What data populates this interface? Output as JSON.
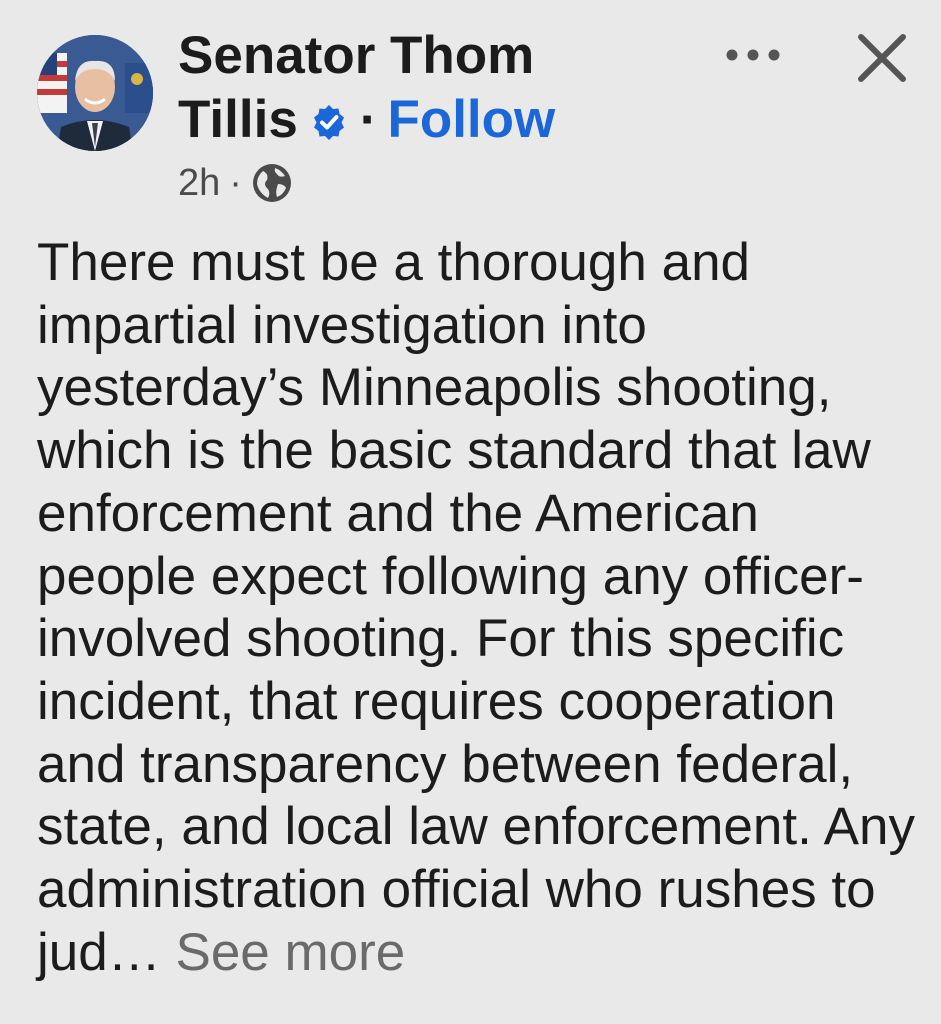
{
  "post": {
    "author_line1": "Senator Thom",
    "author_line2": "Tillis",
    "separator": "·",
    "follow_label": "Follow",
    "timestamp": "2h",
    "meta_separator": "·",
    "body_text": "There must be a thorough and impartial investigation into yesterday’s Minneapolis shooting, which is the basic standard that law enforcement and the American people expect following any officer-involved shooting. For this specific incident, that requires cooperation and transparency between federal, state, and local law enforcement. Any administration official who rushes to jud…",
    "see_more_label": "See more"
  },
  "icons": {
    "verified": "verified-badge-icon",
    "globe": "globe-icon",
    "more": "more-options-icon",
    "close": "close-icon"
  },
  "colors": {
    "background": "#e9e9e9",
    "link_blue": "#1b66d8",
    "text": "#1c1c1c",
    "muted": "#6a6a6a"
  }
}
